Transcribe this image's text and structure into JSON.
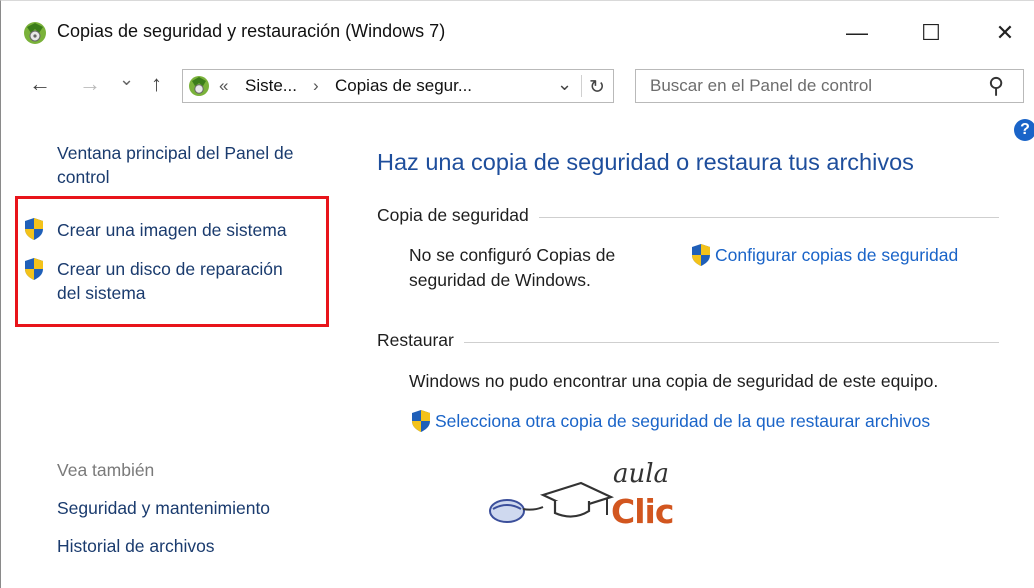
{
  "window": {
    "title": "Copias de seguridad y restauración (Windows 7)",
    "minimize": "—",
    "maximize": "☐",
    "close": "✕"
  },
  "nav": {
    "back": "←",
    "forward": "→",
    "recent": "⌄",
    "up": "↑"
  },
  "address": {
    "chevron": "«",
    "crumb1": "Siste...",
    "separator": "›",
    "crumb2": "Copias de segur...",
    "dropdown": "⌄",
    "refresh": "↻"
  },
  "search": {
    "placeholder": "Buscar en el Panel de control",
    "icon": "⚲"
  },
  "help": {
    "label": "?"
  },
  "sidebar": {
    "home_line1": "Ventana principal del Panel de",
    "home_line2": "control",
    "task1": "Crear una imagen de sistema",
    "task2_line1": "Crear un disco de reparación",
    "task2_line2": "del sistema",
    "see_also": "Vea también",
    "link1": "Seguridad y mantenimiento",
    "link2": "Historial de archivos"
  },
  "main": {
    "heading": "Haz una copia de seguridad o restaura tus archivos",
    "backup_section": "Copia de seguridad",
    "backup_status_line1": "No se configuró Copias de",
    "backup_status_line2": "seguridad de Windows.",
    "configure_link": "Configurar copias de seguridad",
    "restore_section": "Restaurar",
    "restore_status": "Windows no pudo encontrar una copia de seguridad de este equipo.",
    "restore_link": "Selecciona otra copia de seguridad de la que restaurar archivos"
  },
  "watermark": {
    "line1": "aula",
    "line2": "Clic"
  },
  "colors": {
    "link_blue": "#1a64c8",
    "heading_blue": "#1e4e9c",
    "highlight_red": "#e8141a",
    "watermark_orange": "#d2561f"
  }
}
